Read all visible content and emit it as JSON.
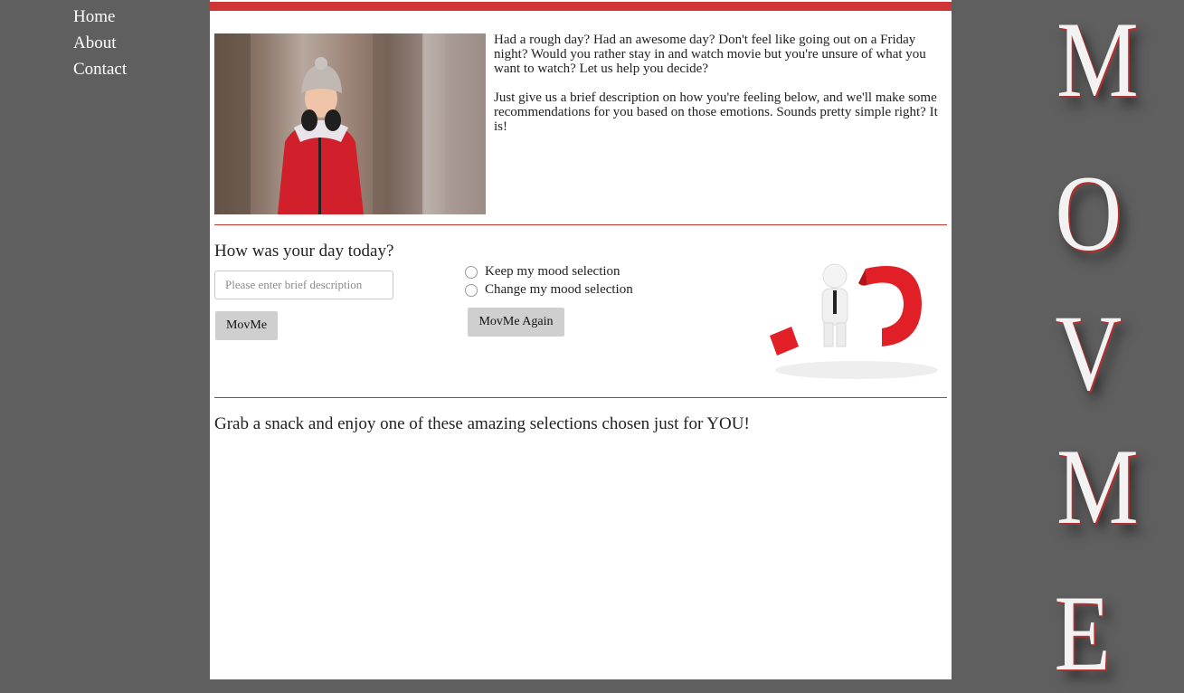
{
  "nav": {
    "items": [
      "Home",
      "About",
      "Contact"
    ]
  },
  "intro": {
    "paragraph1": "Had a rough day? Had an awesome day? Don't feel like going out on a Friday night? Would you rather stay in and watch movie but you're unsure of what you want to watch? Let us help you decide?",
    "paragraph2": "Just give us a brief description on how you're feeling below, and we'll make some recommendations for you based on those emotions. Sounds pretty simple right? It is!"
  },
  "mood": {
    "question": "How was your day today?",
    "input_placeholder": "Please enter brief description",
    "input_value": "",
    "submit_label": "MovMe",
    "radio_keep": "Keep my mood selection",
    "radio_change": "Change my mood selection",
    "again_label": "MovMe Again"
  },
  "results": {
    "heading": "Grab a snack and enjoy one of these amazing selections chosen just for YOU!"
  },
  "side_title": {
    "letters": [
      "M",
      "O",
      "V",
      "M",
      "E"
    ]
  },
  "colors": {
    "background": "#5f5f5f",
    "accent": "#d13636",
    "panel": "#ffffff"
  }
}
